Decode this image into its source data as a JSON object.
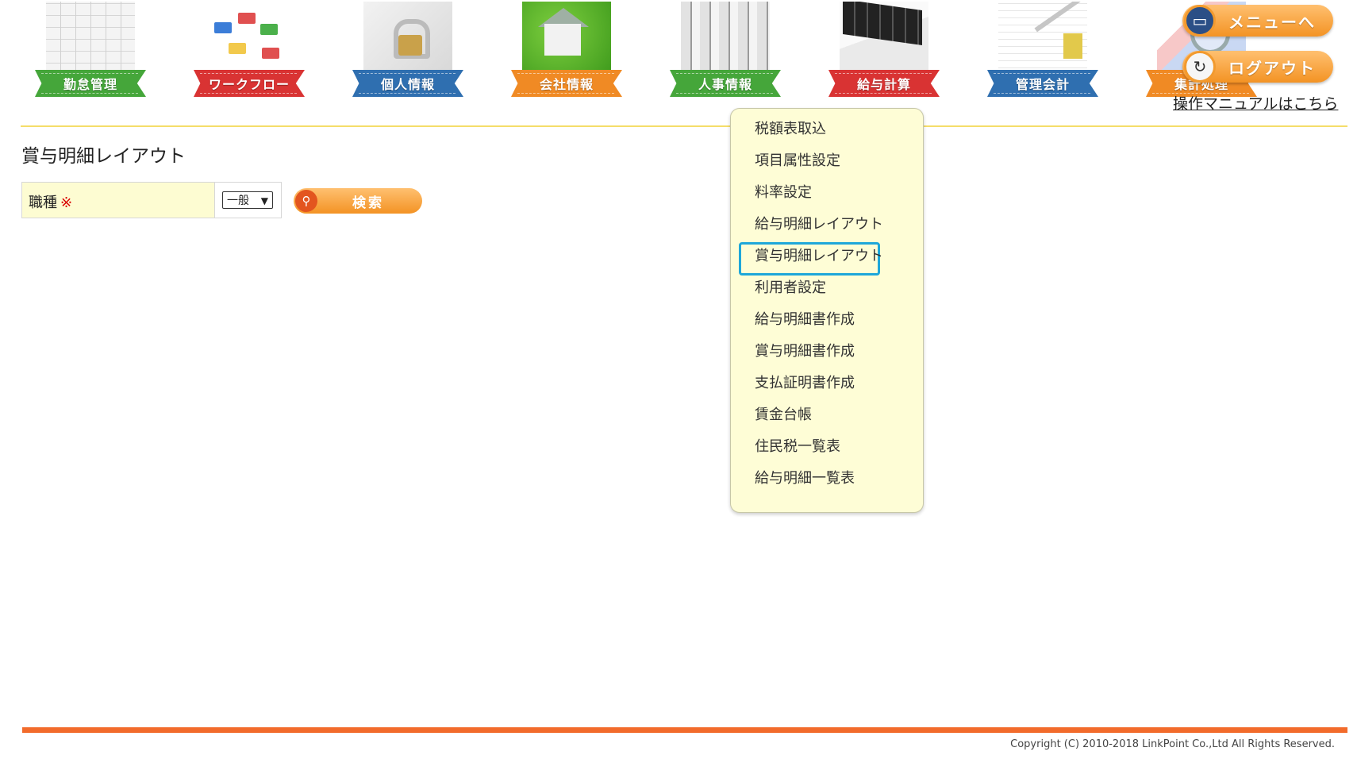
{
  "nav": [
    {
      "label": "勤怠管理",
      "color": "#45a63a",
      "icon": "calendar-icon"
    },
    {
      "label": "ワークフロー",
      "color": "#d93333",
      "icon": "workflow-icon"
    },
    {
      "label": "個人情報",
      "color": "#2f6fb0",
      "icon": "lock-icon"
    },
    {
      "label": "会社情報",
      "color": "#f08a24",
      "icon": "house-icon"
    },
    {
      "label": "人事情報",
      "color": "#45a63a",
      "icon": "files-icon"
    },
    {
      "label": "給与計算",
      "color": "#d93333",
      "icon": "calculator-icon"
    },
    {
      "label": "管理会計",
      "color": "#2f6fb0",
      "icon": "ledger-icon"
    },
    {
      "label": "集計処理",
      "color": "#f08a24",
      "icon": "graph-icon"
    }
  ],
  "header": {
    "menu_label": "メニューへ",
    "logout_label": "ログアウト",
    "manual_link": "操作マニュアルはこちら"
  },
  "page": {
    "title": "賞与明細レイアウト",
    "field_label": "職種",
    "required_mark": "※",
    "select_value": "一般",
    "search_label": "検索"
  },
  "dropdown": {
    "items": [
      "税額表取込",
      "項目属性設定",
      "料率設定",
      "給与明細レイアウト",
      "賞与明細レイアウト",
      "利用者設定",
      "給与明細書作成",
      "賞与明細書作成",
      "支払証明書作成",
      "賃金台帳",
      "住民税一覧表",
      "給与明細一覧表"
    ],
    "active_index": 4
  },
  "footer": {
    "copyright": "Copyright (C) 2010-2018 LinkPoint Co.,Ltd All Rights Reserved."
  },
  "colors": {
    "accent_orange": "#f39324",
    "footer_bar": "#f26b2b",
    "highlight": "#1ea7d9",
    "dropdown_bg": "#fefdd6"
  }
}
